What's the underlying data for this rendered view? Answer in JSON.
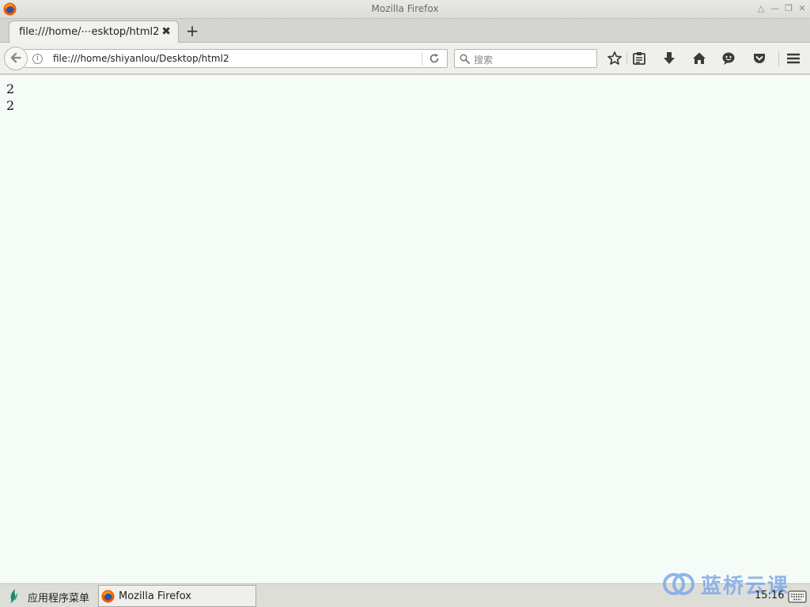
{
  "window": {
    "title": "Mozilla Firefox",
    "controls": [
      "shade",
      "minimize",
      "maximize",
      "close"
    ]
  },
  "tabs": [
    {
      "label": "file:///home/⋯esktop/html2",
      "active": true
    }
  ],
  "navbar": {
    "url": "file:///home/shiyanlou/Desktop/html2",
    "search_placeholder": "搜索",
    "icons": [
      "bookmark-star-icon",
      "reading-list-icon",
      "download-icon",
      "home-icon",
      "chat-icon",
      "pocket-icon",
      "hamburger-menu-icon"
    ]
  },
  "content": {
    "lines": [
      "2",
      "2"
    ]
  },
  "taskbar": {
    "menu_label": "应用程序菜单",
    "task_label": "Mozilla Firefox",
    "watermark": "蓝桥云课",
    "clock": "15:16"
  },
  "colors": {
    "page_background": "#f5fbf7",
    "watermark": "#7fa9e8"
  }
}
